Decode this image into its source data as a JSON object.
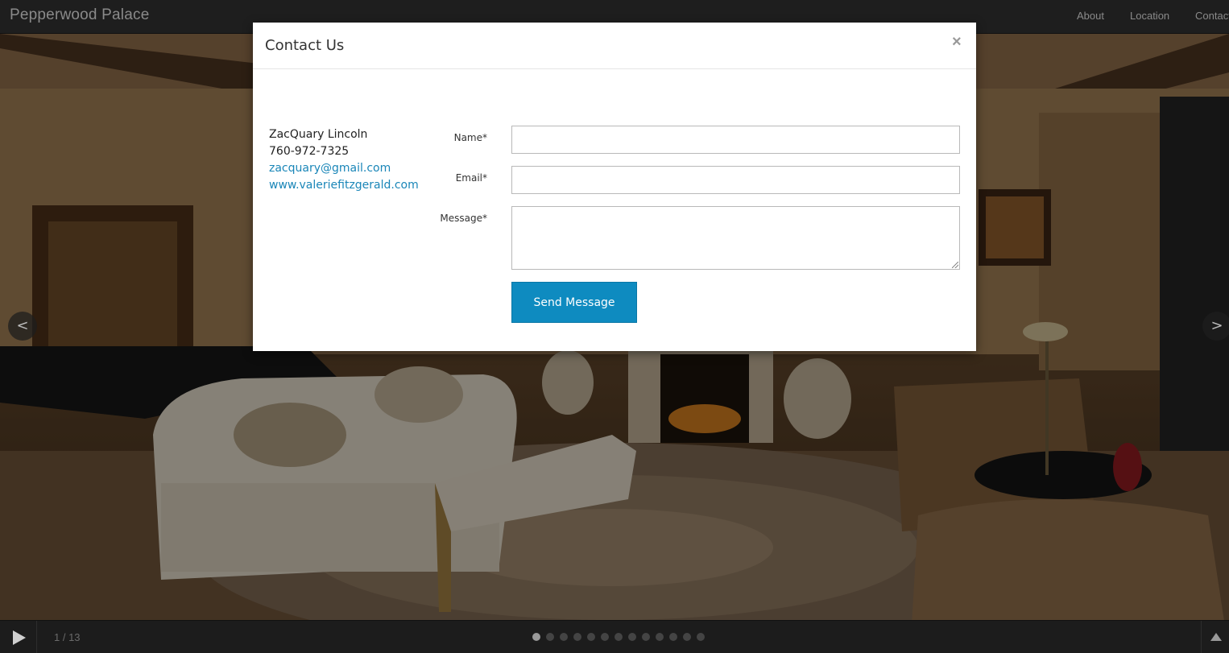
{
  "navbar": {
    "brand": "Pepperwood Palace",
    "links": [
      "About",
      "Location",
      "Contact"
    ]
  },
  "modal": {
    "title": "Contact Us",
    "close_symbol": "×",
    "contact": {
      "name": "ZacQuary Lincoln",
      "phone": "760-972-7325",
      "email": "zacquary@gmail.com",
      "website": "www.valeriefitzgerald.com"
    },
    "form": {
      "name_label": "Name*",
      "email_label": "Email*",
      "message_label": "Message*",
      "name_value": "",
      "email_value": "",
      "message_value": "",
      "submit_label": "Send Message"
    }
  },
  "slideshow": {
    "prev_symbol": "<",
    "next_symbol": ">",
    "counter": "1 / 13",
    "total_slides": 13,
    "active_slide": 1
  },
  "colors": {
    "accent": "#0e8bc0",
    "link": "#1a86b8",
    "navbar_bg": "#1e1e1e",
    "nav_text": "#8a8a8a"
  },
  "icons": {
    "play": "play-icon",
    "close": "close-icon",
    "prev": "chevron-left-icon",
    "next": "chevron-right-icon",
    "thumbs_toggle": "triangle-up-icon"
  }
}
